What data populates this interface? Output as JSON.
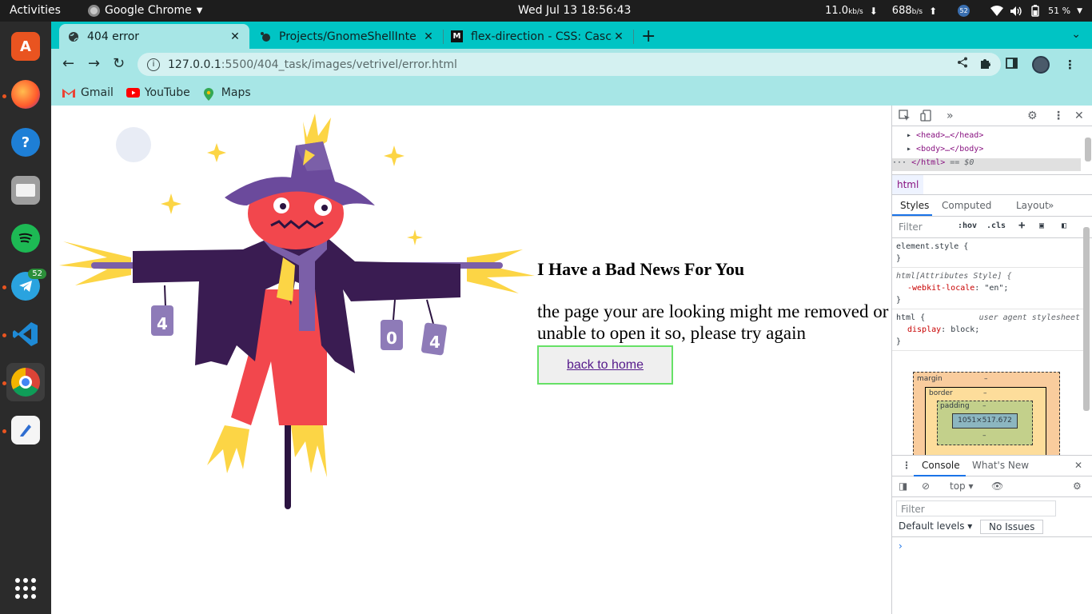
{
  "topbar": {
    "activities": "Activities",
    "app_name": "Google Chrome",
    "clock": "Wed Jul 13  18:56:43",
    "net_down": "11.0",
    "net_down_unit": "kb/s",
    "net_up": "688",
    "net_up_unit": "b/s",
    "notif_count": "52",
    "battery": "51 %"
  },
  "dock": {
    "telegram_badge": "52"
  },
  "tabs": [
    {
      "title": "404 error"
    },
    {
      "title": "Projects/GnomeShellInte"
    },
    {
      "title": "flex-direction - CSS: Casca"
    }
  ],
  "address": {
    "host": "127.0.0.1",
    "path": ":5500/404_task/images/vetrivel/error.html"
  },
  "bookmarks": [
    {
      "label": "Gmail"
    },
    {
      "label": "YouTube"
    },
    {
      "label": "Maps"
    }
  ],
  "page": {
    "scarecrow_digits": [
      "4",
      "0",
      "4"
    ],
    "heading": "I Have a Bad News For You",
    "message": "the page your are looking might me removed or unable to open it so, please try again",
    "button": "back to home"
  },
  "devtools": {
    "dom_head": "<head>…</head>",
    "dom_body": "<body>…</body>",
    "dom_html_close": "</html>",
    "dom_eq": "== $0",
    "crumb": "html",
    "tabs": [
      "Styles",
      "Computed",
      "Layout"
    ],
    "filter_placeholder": "Filter",
    "hov": ":hov",
    "cls": ".cls",
    "rules": {
      "element_style": "element.style {",
      "attr_selector": "html[Attributes Style] {",
      "locale_prop": "-webkit-locale",
      "locale_val": "\"en\";",
      "html_selector": "html {",
      "ua_label": "user agent stylesheet",
      "display_prop": "display",
      "display_val": "block;",
      "close_brace": "}"
    },
    "box_model": {
      "margin": "margin",
      "border": "border",
      "padding": "padding",
      "content_size": "1051×517.672",
      "dash": "–"
    },
    "drawer": {
      "console": "Console",
      "whats_new": "What's New",
      "context": "top",
      "filter": "Filter",
      "levels": "Default levels",
      "issues": "No Issues"
    }
  }
}
